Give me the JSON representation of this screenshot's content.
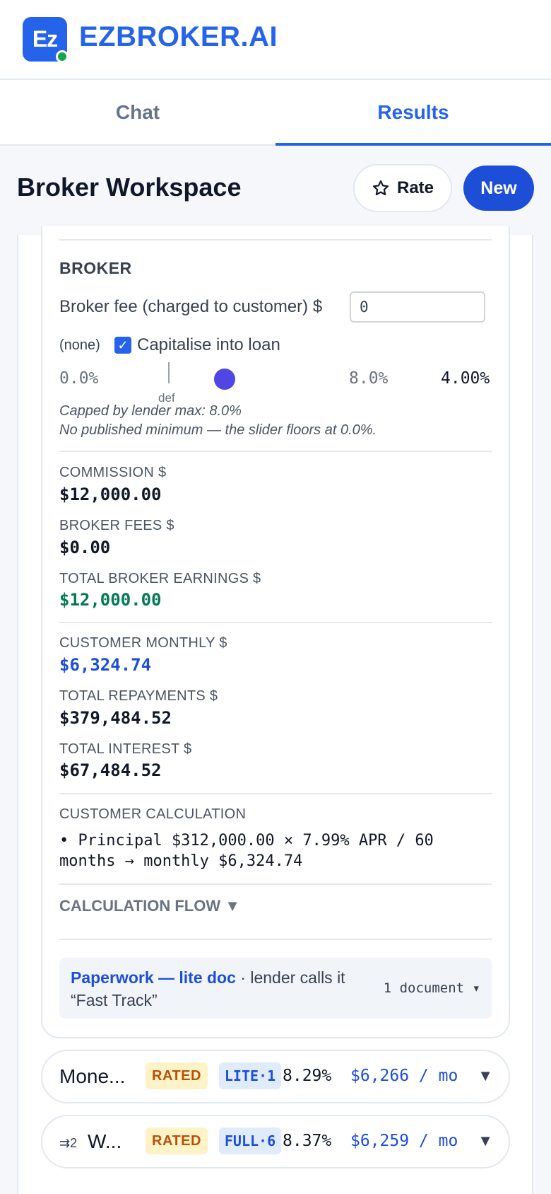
{
  "header": {
    "logo_text": "Ez",
    "brand": "EZBROKER.AI",
    "colors": {
      "brand": "#2563eb",
      "status_dot": "#16a34a"
    }
  },
  "tabs": [
    {
      "label": "Chat",
      "active": false
    },
    {
      "label": "Results",
      "active": true
    }
  ],
  "workspace": {
    "title": "Broker Workspace",
    "rate_label": "Rate",
    "new_label": "New"
  },
  "broker": {
    "section": "BROKER",
    "fee_label": "Broker fee (charged to customer) $",
    "fee_value": "0",
    "none_label": "(none)",
    "capitalise_label": "Capitalise into loan",
    "capitalise_checked": true,
    "slider": {
      "min_label": "0.0%",
      "default_label": "def",
      "max_label": "8.0%",
      "current_label": "4.00%",
      "value": 4.0,
      "min": 0.0,
      "max": 8.0
    },
    "note_cap": "Capped by lender max: 8.0%",
    "note_min": "No published minimum — the slider floors at 0.0%."
  },
  "earnings": {
    "commission_label": "COMMISSION $",
    "commission_value": "$12,000.00",
    "fees_label": "BROKER FEES $",
    "fees_value": "$0.00",
    "total_label": "TOTAL BROKER EARNINGS $",
    "total_value": "$12,000.00"
  },
  "customer": {
    "monthly_label": "CUSTOMER MONTHLY $",
    "monthly_value": "$6,324.74",
    "repayments_label": "TOTAL REPAYMENTS $",
    "repayments_value": "$379,484.52",
    "interest_label": "TOTAL INTEREST $",
    "interest_value": "$67,484.52"
  },
  "calculation": {
    "label": "CUSTOMER CALCULATION",
    "line": "•  Principal $312,000.00 × 7.99% APR / 60 months → monthly $6,324.74",
    "flow_label": "CALCULATION FLOW ▼"
  },
  "paperwork": {
    "link": "Paperwork — lite doc",
    "rest": " · lender calls it “Fast Track”",
    "docs": "1 document ▾"
  },
  "lenders": [
    {
      "prefix": "",
      "name": "Mone...",
      "status": "RATED",
      "doc": "LITE·1",
      "rate": "8.29%",
      "monthly": "$6,266 / mo",
      "caret": "▼"
    },
    {
      "prefix": "⇉2",
      "name": "W...",
      "status": "RATED",
      "doc": "FULL·6",
      "rate": "8.37%",
      "monthly": "$6,259 / mo",
      "caret": "▼"
    }
  ]
}
